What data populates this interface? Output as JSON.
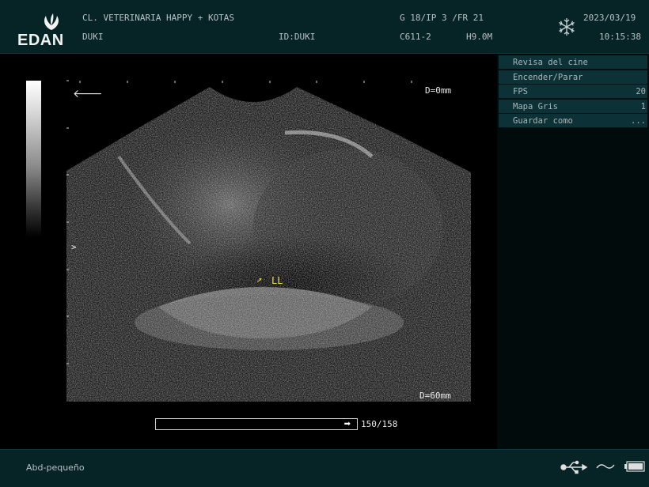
{
  "header": {
    "brand": "EDAN",
    "clinic": "CL. VETERINARIA HAPPY + KOTAS",
    "patient": "DUKI",
    "patient_id": "ID:DUKI",
    "params": "G 18/IP 3 /FR 21",
    "probe": "C611-2",
    "freq": "H9.0M",
    "date": "2023/03/19",
    "time": "10:15:38"
  },
  "image": {
    "depth_top": "D=0mm",
    "depth_bottom": "D=60mm",
    "focus_marker": ">",
    "annotation_arrow": "↗",
    "annotation_label": "LL",
    "cine_frame": "150/158"
  },
  "menu": [
    {
      "label": "Revisa del cine",
      "value": ""
    },
    {
      "label": "Encender/Parar",
      "value": ""
    },
    {
      "label": "FPS",
      "value": "20"
    },
    {
      "label": "Mapa Gris",
      "value": "1"
    },
    {
      "label": "Guardar como",
      "value": "..."
    }
  ],
  "footer": {
    "preset": "Abd-pequeño"
  },
  "icons": [
    "edan-logo-icon",
    "freeze-snowflake-icon",
    "back-arrow-icon",
    "usb-icon",
    "network-wave-icon",
    "battery-icon"
  ],
  "colors": {
    "panel": "#062326",
    "menu_item": "#0c3136",
    "annotation": "#e6d84a"
  }
}
